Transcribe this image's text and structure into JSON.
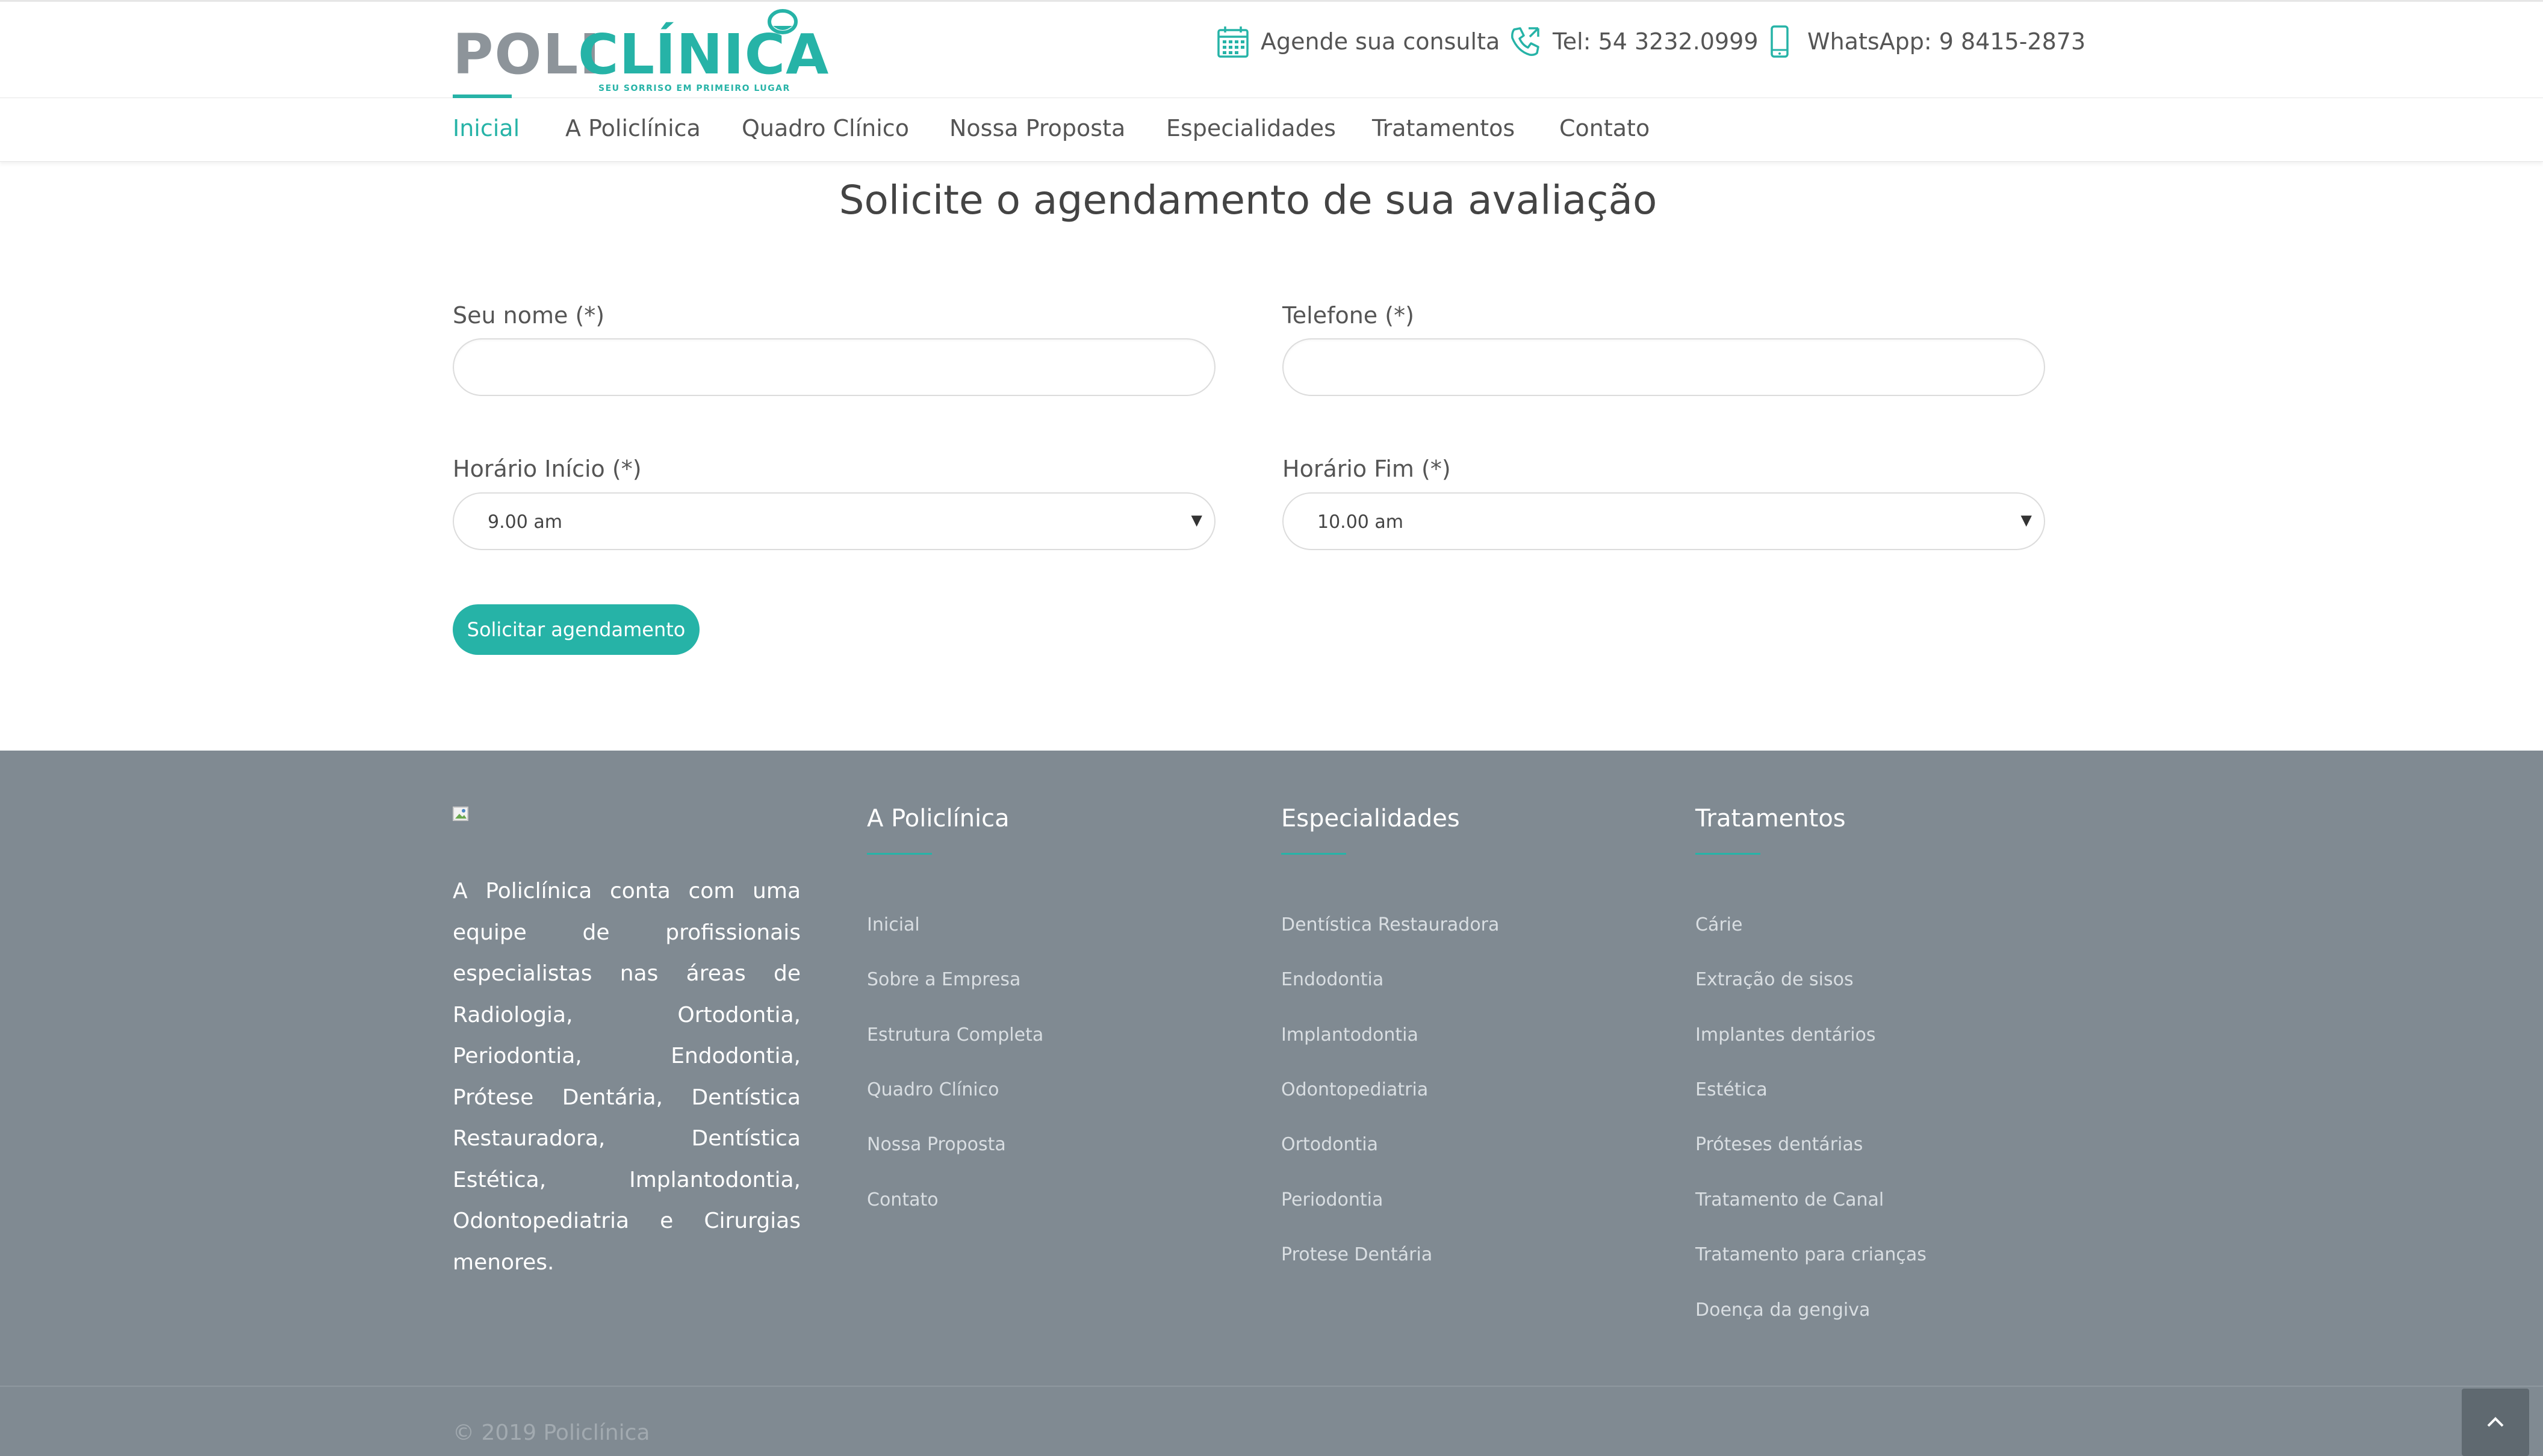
{
  "header": {
    "logo": {
      "part1": "POLI",
      "part2": "CLÍNICA",
      "tagline": "SEU SORRISO EM PRIMEIRO LUGAR"
    },
    "contacts": [
      {
        "icon": "calendar-icon",
        "label": "Agende sua consulta"
      },
      {
        "icon": "phone-icon",
        "label": "Tel: 54 3232.0999"
      },
      {
        "icon": "mobile-phone-icon",
        "label": "WhatsApp: 9 8415-2873"
      }
    ]
  },
  "nav": {
    "items": [
      {
        "label": "Inicial",
        "active": true
      },
      {
        "label": "A Policlínica"
      },
      {
        "label": "Quadro Clínico"
      },
      {
        "label": "Nossa Proposta"
      },
      {
        "label": "Especialidades"
      },
      {
        "label": "Tratamentos"
      },
      {
        "label": "Contato"
      }
    ]
  },
  "form": {
    "title": "Solicite o agendamento de sua avaliação",
    "name_label": "Seu nome (*)",
    "name_value": "",
    "phone_label": "Telefone (*)",
    "phone_value": "",
    "start_label": "Horário Início (*)",
    "start_value": "9.00 am",
    "end_label": "Horário Fim (*)",
    "end_value": "10.00 am",
    "submit_label": "Solicitar agendamento"
  },
  "footer": {
    "about": "A Policlínica conta com uma equipe de profissionais especialistas nas áreas de Radiologia, Ortodontia, Periodontia, Endodontia, Prótese Dentária, Dentística Restauradora, Dentística Estética, Implantodontia, Odontopediatria e Cirurgias menores.",
    "columns": [
      {
        "title": "A Policlínica",
        "links": [
          "Inicial",
          "Sobre a Empresa",
          "Estrutura Completa",
          "Quadro Clínico",
          "Nossa Proposta",
          "Contato"
        ]
      },
      {
        "title": "Especialidades",
        "links": [
          "Dentística Restauradora",
          "Endodontia",
          "Implantodontia",
          "Odontopediatria",
          "Ortodontia",
          "Periodontia",
          "Protese Dentária"
        ]
      },
      {
        "title": "Tratamentos",
        "links": [
          "Cárie",
          "Extração de sisos",
          "Implantes dentários",
          "Estética",
          "Próteses dentárias",
          "Tratamento de Canal",
          "Tratamento para crianças",
          "Doença da gengiva"
        ]
      }
    ],
    "copyright": "© 2019 Policlínica"
  },
  "colors": {
    "accent": "#26b3a7",
    "logo_gray": "#8d949a",
    "footer_bg": "#808a92",
    "scroll_btn": "#5f6970"
  }
}
